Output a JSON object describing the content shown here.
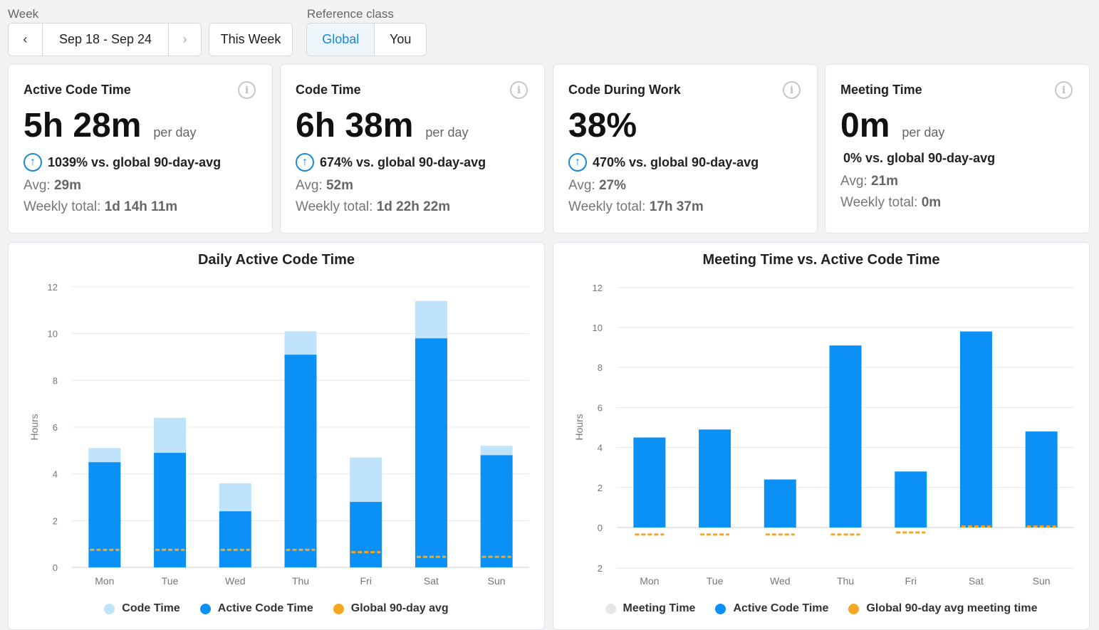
{
  "filters": {
    "week_label": "Week",
    "week_range": "Sep 18 - Sep 24",
    "this_week": "This Week",
    "ref_label": "Reference class",
    "ref_options": [
      "Global",
      "You"
    ],
    "ref_selected": "Global"
  },
  "cards": [
    {
      "title": "Active Code Time",
      "value": "5h 28m",
      "per": "per day",
      "compare": "1039% vs. global 90-day-avg",
      "trend": "up",
      "avg_label": "Avg:",
      "avg": "29m",
      "total_label": "Weekly total:",
      "total": "1d 14h 11m"
    },
    {
      "title": "Code Time",
      "value": "6h 38m",
      "per": "per day",
      "compare": "674% vs. global 90-day-avg",
      "trend": "up",
      "avg_label": "Avg:",
      "avg": "52m",
      "total_label": "Weekly total:",
      "total": "1d 22h 22m"
    },
    {
      "title": "Code During Work",
      "value": "38%",
      "per": "",
      "compare": "470% vs. global 90-day-avg",
      "trend": "up",
      "avg_label": "Avg:",
      "avg": "27%",
      "total_label": "Weekly total:",
      "total": "17h 37m"
    },
    {
      "title": "Meeting Time",
      "value": "0m",
      "per": "per day",
      "compare": "0% vs. global 90-day-avg",
      "trend": "none",
      "avg_label": "Avg:",
      "avg": "21m",
      "total_label": "Weekly total:",
      "total": "0m"
    }
  ],
  "colors": {
    "code_time": "#bfe3fb",
    "active_code_time": "#0b90f5",
    "global_avg": "#f5a623",
    "meeting_time": "#e6e6e6",
    "accent": "#1a8ad8"
  },
  "chart_data": [
    {
      "type": "bar",
      "stacked": true,
      "title": "Daily Active Code Time",
      "ylabel": "Hours",
      "xlabel": "",
      "ylim": [
        0,
        12
      ],
      "yticks": [
        0,
        2,
        4,
        6,
        8,
        10,
        12
      ],
      "grid": true,
      "legend": "bottom",
      "categories": [
        "Mon",
        "Tue",
        "Wed",
        "Thu",
        "Fri",
        "Sat",
        "Sun"
      ],
      "series": [
        {
          "name": "Code Time",
          "values": [
            5.1,
            6.4,
            3.6,
            10.1,
            4.7,
            11.4,
            5.2
          ]
        },
        {
          "name": "Active Code Time",
          "values": [
            4.5,
            4.9,
            2.4,
            9.1,
            2.8,
            9.8,
            4.8
          ]
        },
        {
          "name": "Global 90-day avg",
          "values": [
            0.75,
            0.75,
            0.75,
            0.75,
            0.65,
            0.45,
            0.45
          ]
        }
      ]
    },
    {
      "type": "bar",
      "title": "Meeting Time vs. Active Code Time",
      "ylabel": "Hours",
      "xlabel": "",
      "ylim": [
        -2,
        12
      ],
      "yticks": [
        12,
        10,
        8,
        6,
        4,
        2,
        0,
        2
      ],
      "grid": true,
      "legend": "bottom",
      "categories": [
        "Mon",
        "Tue",
        "Wed",
        "Thu",
        "Fri",
        "Sat",
        "Sun"
      ],
      "series": [
        {
          "name": "Meeting Time",
          "values": [
            0,
            0,
            0,
            0,
            0,
            0,
            0
          ]
        },
        {
          "name": "Active Code Time",
          "values": [
            4.5,
            4.9,
            2.4,
            9.1,
            2.8,
            9.8,
            4.8
          ]
        },
        {
          "name": "Global 90-day avg meeting time",
          "values": [
            -0.35,
            -0.35,
            -0.35,
            -0.35,
            -0.25,
            0.05,
            0.05
          ]
        }
      ]
    }
  ]
}
